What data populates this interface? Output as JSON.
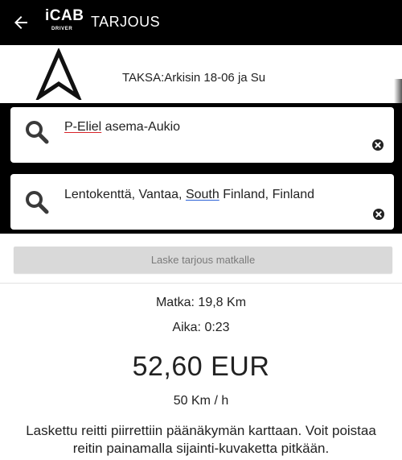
{
  "appbar": {
    "logo_main": "iCAB",
    "logo_sub": "DRIVER",
    "title": "TARJOUS"
  },
  "tariff": {
    "text": "TAKSA:Arkisin 18-06 ja Su"
  },
  "from_field": {
    "underlined": "P-Eliel",
    "rest": " asema-Aukio"
  },
  "to_field": {
    "part1": "Lentokenttä, Vantaa, ",
    "underlined": "South",
    "part2": " Finland, Finland"
  },
  "calc_button": {
    "label": "Laske tarjous matkalle"
  },
  "result": {
    "distance": "Matka: 19,8 Km",
    "duration": "Aika: 0:23",
    "price": "52,60 EUR",
    "speed": "50 Km / h",
    "info": "Laskettu reitti piirrettiin päänäkymän karttaan. Voit poistaa reitin painamalla sijainti-kuvaketta pitkään."
  },
  "colors": {
    "appbar": "#000000",
    "card": "#ffffff",
    "button_disabled": "#d9d9d9",
    "spell_red": "#d8232a",
    "link_blue": "#2d62d6"
  },
  "icons": [
    "back-arrow-icon",
    "navigation-arrow-icon",
    "search-icon",
    "clear-icon"
  ]
}
